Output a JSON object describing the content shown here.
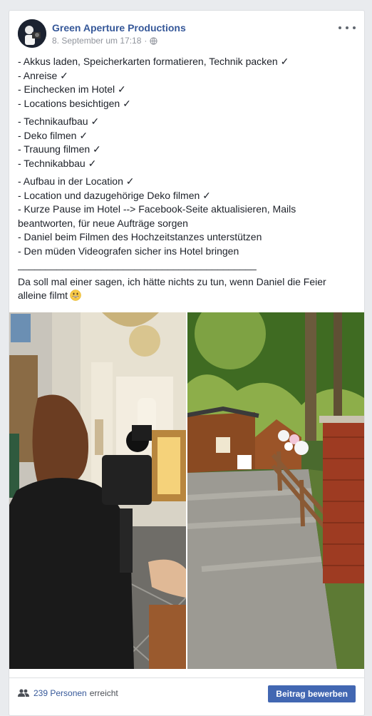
{
  "post": {
    "author": "Green Aperture Productions",
    "timestamp": "8. September um 17:18",
    "separator": "·",
    "privacy_icon": "globe-icon",
    "more_icon": "more-options-icon",
    "groups": [
      [
        "- Akkus laden, Speicherkarten formatieren, Technik packen ✓",
        "- Anreise ✓",
        "- Einchecken im Hotel ✓",
        "- Locations besichtigen ✓"
      ],
      [
        "- Technikaufbau ✓",
        "- Deko filmen ✓",
        "- Trauung filmen ✓",
        "- Technikabbau ✓"
      ],
      [
        "- Aufbau in der Location ✓",
        "- Location und dazugehörige Deko filmen ✓",
        "- Kurze Pause im Hotel --> Facebook-Seite aktualisieren, Mails beantworten, für neue Aufträge sorgen",
        "- Daniel beim Filmen des Hochzeitstanzes unterstützen",
        "- Den müden Videografen sicher ins Hotel bringen"
      ]
    ],
    "divider": "___________________________________________",
    "closing": "Da soll mal einer sagen, ich hätte nichts zu tun, wenn Daniel die Feier alleine filmt",
    "closing_emoji": "grinning-face-emoji"
  },
  "photos": [
    {
      "name": "church-filming-photo",
      "subject": "videographer filming in church interior"
    },
    {
      "name": "wedding-venue-path-photo",
      "subject": "gravel path to wooden forest cabin with balloons"
    }
  ],
  "footer": {
    "people_icon": "people-icon",
    "reach_count": "239 Personen",
    "reach_suffix": "erreicht",
    "boost_label": "Beitrag bewerben"
  },
  "colors": {
    "link": "#365899",
    "button": "#4267b2",
    "background": "#e9ebee"
  }
}
